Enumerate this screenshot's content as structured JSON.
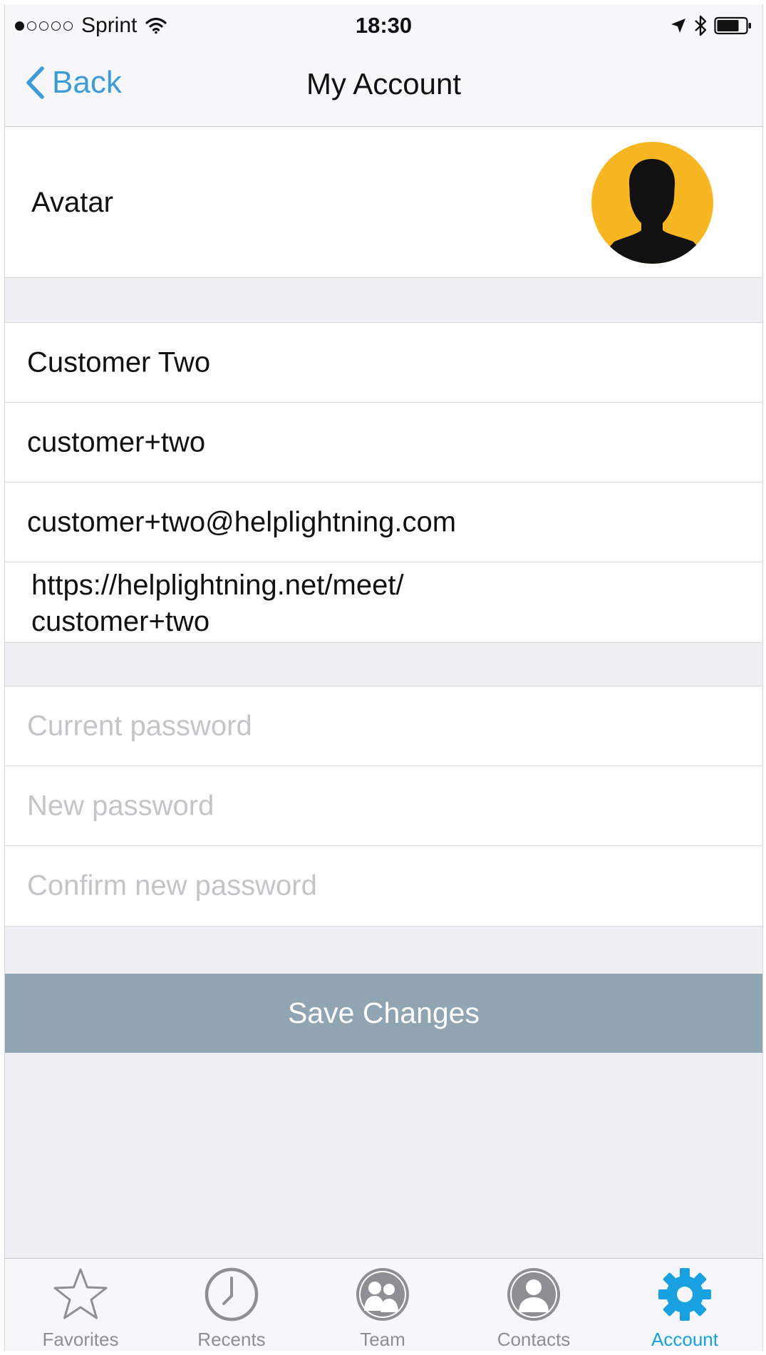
{
  "status_bar": {
    "carrier": "Sprint",
    "time": "18:30"
  },
  "nav": {
    "back_label": "Back",
    "title": "My Account"
  },
  "avatar_row": {
    "label": "Avatar"
  },
  "profile": {
    "name": "Customer Two",
    "username": "customer+two",
    "email": "customer+two@helplightning.com",
    "meet_url_line1": "https://helplightning.net/meet/",
    "meet_url_line2": "customer+two"
  },
  "password": {
    "current_placeholder": "Current password",
    "new_placeholder": "New password",
    "confirm_placeholder": "Confirm new password"
  },
  "save_button": {
    "label": "Save Changes",
    "color": "#91a4b1"
  },
  "tabbar": {
    "active_color": "#18a0e0",
    "inactive_color": "#8e8e93",
    "tabs": [
      {
        "label": "Favorites",
        "icon": "star-icon"
      },
      {
        "label": "Recents",
        "icon": "clock-icon"
      },
      {
        "label": "Team",
        "icon": "team-icon"
      },
      {
        "label": "Contacts",
        "icon": "contact-icon"
      },
      {
        "label": "Account",
        "icon": "gear-icon",
        "active": true
      }
    ]
  },
  "colors": {
    "accent": "#3d9bd6",
    "avatar_bg": "#f8b623"
  }
}
